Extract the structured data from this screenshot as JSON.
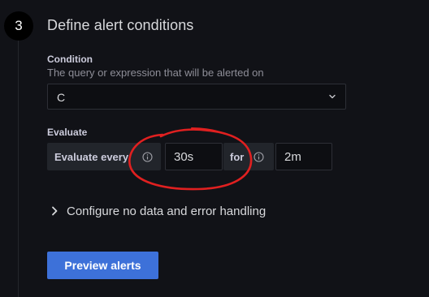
{
  "step": {
    "number": "3",
    "title": "Define alert conditions"
  },
  "condition": {
    "label": "Condition",
    "description": "The query or expression that will be alerted on",
    "selected": "C",
    "icon": "chevron-down-icon"
  },
  "evaluate": {
    "label": "Evaluate",
    "every_label": "Evaluate every",
    "every_value": "30s",
    "for_label": "for",
    "for_value": "2m",
    "info_icon": "info-circle-icon"
  },
  "no_data": {
    "label": "Configure no data and error handling",
    "icon": "chevron-right-icon"
  },
  "preview_button": {
    "label": "Preview alerts"
  },
  "colors": {
    "background": "#111217",
    "accent": "#3d71d9",
    "annotation": "#e02020"
  }
}
